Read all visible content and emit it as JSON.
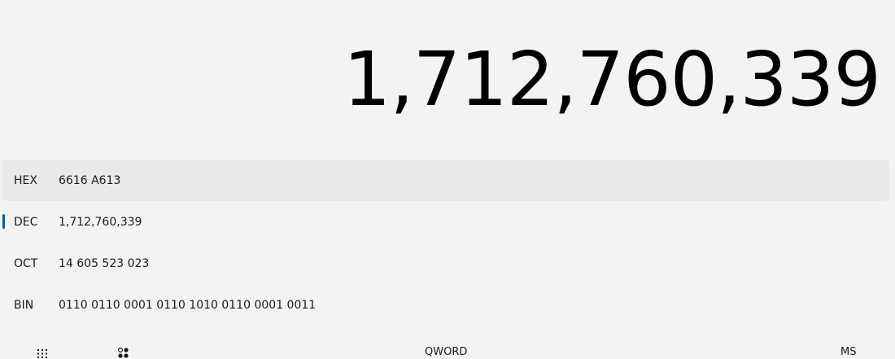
{
  "display": {
    "value": "1,712,760,339"
  },
  "radix": {
    "rows": [
      {
        "name": "HEX",
        "value": "6616 A613"
      },
      {
        "name": "DEC",
        "value": "1,712,760,339"
      },
      {
        "name": "OCT",
        "value": "14 605 523 023"
      },
      {
        "name": "BIN",
        "value": "0110 0110 0001 0110 1010 0110 0001 0011"
      }
    ],
    "hovered": "HEX",
    "selected": "DEC"
  },
  "toolbar": {
    "keypad_icon": "full-keypad-icon",
    "bitshift_icon": "bit-toggling-keypad-icon",
    "word_size_label": "QWORD",
    "memory_store_label": "MS"
  },
  "colors": {
    "background": "#f3f3f3",
    "hover_row": "#e9e9e9",
    "accent": "#005a9e"
  }
}
